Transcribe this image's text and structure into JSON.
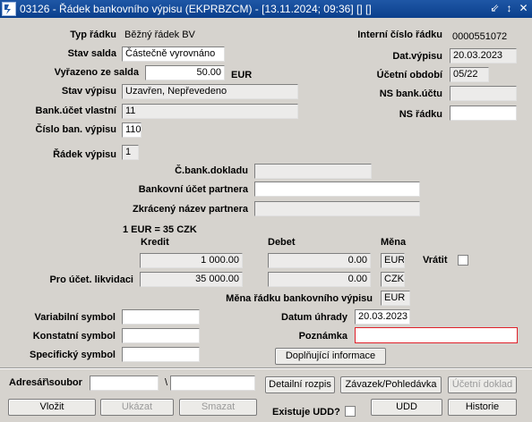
{
  "window": {
    "title": "03126 - Řádek bankovního výpisu (EKPRBZCM) - [13.11.2024; 09:36] [] []",
    "controls": [
      "⇙",
      "↕",
      "✕"
    ]
  },
  "left": {
    "typ_radku_label": "Typ řádku",
    "typ_radku_value": "Běžný řádek BV",
    "stav_salda_label": "Stav salda",
    "stav_salda_value": "Částečně vyrovnáno",
    "vyrazeno_label": "Vyřazeno ze salda",
    "vyrazeno_value": "50.00",
    "vyrazeno_currency": "EUR",
    "stav_vypisu_label": "Stav výpisu",
    "stav_vypisu_value": "Uzavřen, Nepřevedeno",
    "bank_ucet_label": "Bank.účet vlastní",
    "bank_ucet_value": "11",
    "cislo_ban_label": "Číslo ban. výpisu",
    "cislo_ban_value": "110",
    "radek_vypisu_label": "Řádek výpisu",
    "radek_vypisu_value": "1"
  },
  "right": {
    "interni_cislo_label": "Interní číslo řádku",
    "interni_cislo_value": "0000551072",
    "dat_vypisu_label": "Dat.výpisu",
    "dat_vypisu_value": "20.03.2023",
    "ucetni_obdobi_label": "Účetní období",
    "ucetni_obdobi_value": "05/22",
    "ns_bank_label": "NS bank.účtu",
    "ns_bank_value": "",
    "ns_radku_label": "NS řádku",
    "ns_radku_value": ""
  },
  "partner": {
    "c_bank_dokladu_label": "Č.bank.dokladu",
    "c_bank_dokladu_value": "",
    "bank_ucet_partnera_label": "Bankovní účet partnera",
    "bank_ucet_partnera_value": "",
    "zkraceny_nazev_label": "Zkrácený název partnera",
    "zkraceny_nazev_value": ""
  },
  "amounts": {
    "rate_text": "1 EUR = 35 CZK",
    "kredit_header": "Kredit",
    "debet_header": "Debet",
    "mena_header": "Měna",
    "row1_kredit": "1 000.00",
    "row1_debet": "0.00",
    "row1_mena": "EUR",
    "vratit_label": "Vrátit",
    "pro_ucet_label": "Pro účet. likvidaci",
    "row2_kredit": "35 000.00",
    "row2_debet": "0.00",
    "row2_mena": "CZK",
    "mena_radku_label": "Měna řádku bankovního výpisu",
    "mena_radku_value": "EUR"
  },
  "symbols": {
    "variabilni_label": "Variabilní symbol",
    "variabilni_value": "",
    "konstatni_label": "Konstatní symbol",
    "konstatni_value": "",
    "specificky_label": "Specifický symbol",
    "specificky_value": "",
    "datum_uhrady_label": "Datum úhrady",
    "datum_uhrady_value": "20.03.2023",
    "poznamka_label": "Poznámka",
    "poznamka_value": "",
    "doplnujici_button": "Doplňující informace"
  },
  "footer": {
    "adresar_label": "Adresář\\soubor",
    "adresar_value": "",
    "slash": "\\",
    "soubor_value": "",
    "detailni_rozpis": "Detailní rozpis",
    "zavazek": "Závazek/Pohledávka",
    "ucetni_doklad": "Účetní doklad",
    "vlozit": "Vložit",
    "ukazat": "Ukázat",
    "smazat": "Smazat",
    "existuje_udd": "Existuje UDD?",
    "udd": "UDD",
    "historie": "Historie"
  },
  "colors": {
    "title_bar": "#0b3f8c",
    "required_border": "#e0202a",
    "window_bg": "#d6d3ce"
  }
}
